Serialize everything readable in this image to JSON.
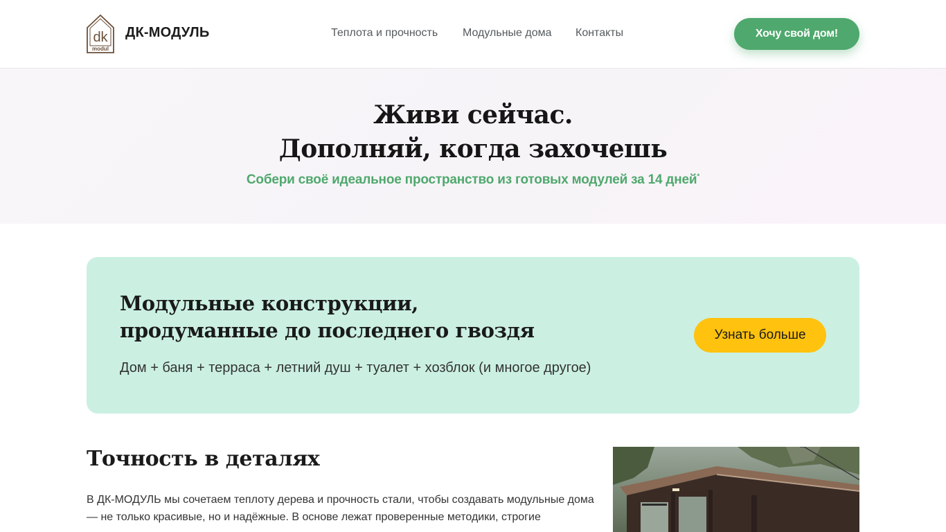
{
  "header": {
    "logo": {
      "mark": "dk",
      "caption": "modul",
      "icon": "house-logo-icon"
    },
    "brand": "ДК-МОДУЛЬ",
    "nav": [
      {
        "label": "Теплота и прочность"
      },
      {
        "label": "Модульные дома"
      },
      {
        "label": "Контакты"
      }
    ],
    "cta_label": "Хочу свой дом!"
  },
  "hero": {
    "title_line1": "Живи сейчас.",
    "title_line2": "Дополняй, когда захочешь",
    "subtitle": "Собери своё идеальное пространство из готовых модулей за 14 дней",
    "footnote_mark": "*"
  },
  "card": {
    "title_line1": "Модульные конструкции,",
    "title_line2": "продуманные до последнего гвоздя",
    "text": "Дом + баня + терраса + летний душ + туалет + хозблок (и многое другое)",
    "button_label": "Узнать больше"
  },
  "section": {
    "title": "Точность в деталях",
    "text": "В ДК-МОДУЛЬ мы сочетаем теплоту дерева и прочность стали, чтобы создавать модульные дома — не только красивые, но и надёжные. В основе лежат проверенные методики, строгие"
  },
  "colors": {
    "accent_green": "#4fa86d",
    "card_bg": "#cbf0e2",
    "button_yellow": "#ffc20e"
  }
}
